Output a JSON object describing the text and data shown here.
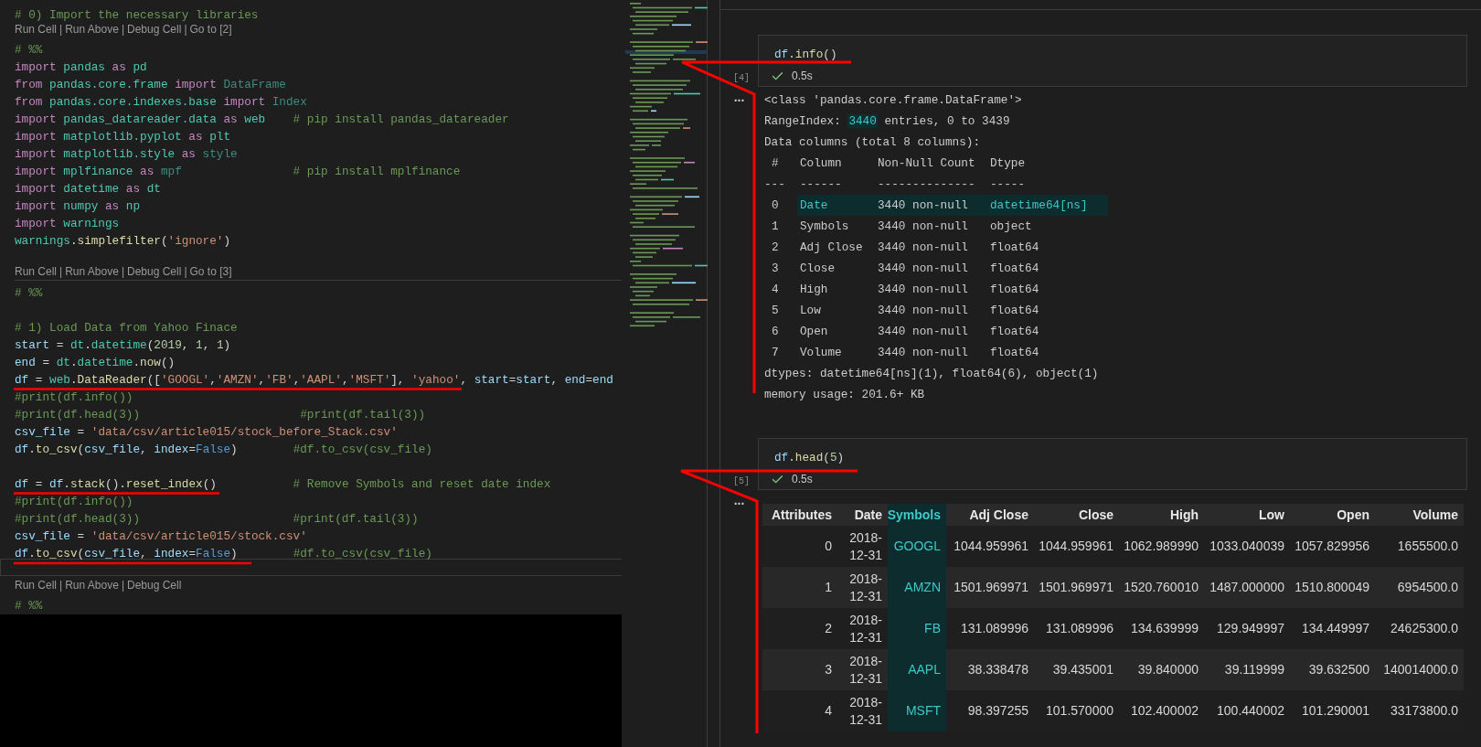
{
  "editor": {
    "lines": [
      {
        "kind": "code",
        "current": false,
        "tokens": [
          {
            "text": "# 0) Import the necessary libraries",
            "kind": "comment"
          }
        ]
      },
      {
        "kind": "codelens",
        "divider_below": false,
        "items": [
          {
            "text": "Run Cell",
            "kind": "link"
          },
          {
            "text": "|",
            "kind": "sep"
          },
          {
            "text": "Run Above",
            "kind": "link"
          },
          {
            "text": "|",
            "kind": "sep"
          },
          {
            "text": "Debug Cell",
            "kind": "link"
          },
          {
            "text": "|",
            "kind": "sep"
          },
          {
            "text": "Go to [2]",
            "kind": "link"
          }
        ]
      },
      {
        "kind": "code",
        "current": false,
        "tokens": [
          {
            "text": "# %%",
            "kind": "comment"
          }
        ]
      },
      {
        "kind": "code",
        "current": false,
        "tokens": [
          {
            "text": "import",
            "kind": "kw"
          },
          {
            "text": " pandas",
            "kind": "mod"
          },
          {
            "text": " as",
            "kind": "kw"
          },
          {
            "text": " pd",
            "kind": "mod"
          }
        ]
      },
      {
        "kind": "code",
        "current": false,
        "tokens": [
          {
            "text": "from",
            "kind": "kw"
          },
          {
            "text": " pandas.core.frame",
            "kind": "mod"
          },
          {
            "text": " import",
            "kind": "kw"
          },
          {
            "text": " DataFrame",
            "kind": "faded"
          }
        ]
      },
      {
        "kind": "code",
        "current": false,
        "tokens": [
          {
            "text": "from",
            "kind": "kw"
          },
          {
            "text": " pandas.core.indexes.base",
            "kind": "mod"
          },
          {
            "text": " import",
            "kind": "kw"
          },
          {
            "text": " Index",
            "kind": "faded"
          }
        ]
      },
      {
        "kind": "code",
        "current": false,
        "tokens": [
          {
            "text": "import",
            "kind": "kw"
          },
          {
            "text": " pandas_datareader.data",
            "kind": "mod"
          },
          {
            "text": " as",
            "kind": "kw"
          },
          {
            "text": " web",
            "kind": "mod"
          },
          {
            "text": "    # pip install pandas_datareader",
            "kind": "comment"
          }
        ]
      },
      {
        "kind": "code",
        "current": false,
        "tokens": [
          {
            "text": "import",
            "kind": "kw"
          },
          {
            "text": " matplotlib.pyplot",
            "kind": "mod"
          },
          {
            "text": " as",
            "kind": "kw"
          },
          {
            "text": " plt",
            "kind": "mod"
          }
        ]
      },
      {
        "kind": "code",
        "current": false,
        "tokens": [
          {
            "text": "import",
            "kind": "kw"
          },
          {
            "text": " matplotlib.style",
            "kind": "mod"
          },
          {
            "text": " as",
            "kind": "kw"
          },
          {
            "text": " style",
            "kind": "faded"
          }
        ]
      },
      {
        "kind": "code",
        "current": false,
        "tokens": [
          {
            "text": "import",
            "kind": "kw"
          },
          {
            "text": " mplfinance",
            "kind": "mod"
          },
          {
            "text": " as",
            "kind": "kw"
          },
          {
            "text": " mpf",
            "kind": "faded"
          },
          {
            "text": "                # pip install mplfinance",
            "kind": "comment"
          }
        ]
      },
      {
        "kind": "code",
        "current": false,
        "tokens": [
          {
            "text": "import",
            "kind": "kw"
          },
          {
            "text": " datetime",
            "kind": "mod"
          },
          {
            "text": " as",
            "kind": "kw"
          },
          {
            "text": " dt",
            "kind": "mod"
          }
        ]
      },
      {
        "kind": "code",
        "current": false,
        "tokens": [
          {
            "text": "import",
            "kind": "kw"
          },
          {
            "text": " numpy",
            "kind": "mod"
          },
          {
            "text": " as",
            "kind": "kw"
          },
          {
            "text": " np",
            "kind": "mod"
          }
        ]
      },
      {
        "kind": "code",
        "current": false,
        "tokens": [
          {
            "text": "import",
            "kind": "kw"
          },
          {
            "text": " warnings",
            "kind": "mod"
          }
        ]
      },
      {
        "kind": "code",
        "current": false,
        "tokens": [
          {
            "text": "warnings",
            "kind": "mod"
          },
          {
            "text": ".",
            "kind": "plain"
          },
          {
            "text": "simplefilter",
            "kind": "fn"
          },
          {
            "text": "(",
            "kind": "plain"
          },
          {
            "text": "'ignore'",
            "kind": "str"
          },
          {
            "text": ")",
            "kind": "plain"
          }
        ]
      },
      {
        "kind": "blank",
        "current": false
      },
      {
        "kind": "codelens",
        "divider_below": true,
        "items": [
          {
            "text": "Run Cell",
            "kind": "link"
          },
          {
            "text": "|",
            "kind": "sep"
          },
          {
            "text": "Run Above",
            "kind": "link"
          },
          {
            "text": "|",
            "kind": "sep"
          },
          {
            "text": "Debug Cell",
            "kind": "link"
          },
          {
            "text": "|",
            "kind": "sep"
          },
          {
            "text": "Go to [3]",
            "kind": "link"
          }
        ]
      },
      {
        "kind": "code",
        "current": false,
        "tokens": [
          {
            "text": "# %%",
            "kind": "comment"
          }
        ]
      },
      {
        "kind": "blank",
        "current": false
      },
      {
        "kind": "code",
        "current": false,
        "tokens": [
          {
            "text": "# 1) Load Data from Yahoo Finace",
            "kind": "comment"
          }
        ]
      },
      {
        "kind": "code",
        "current": false,
        "tokens": [
          {
            "text": "start",
            "kind": "var"
          },
          {
            "text": " = ",
            "kind": "plain"
          },
          {
            "text": "dt",
            "kind": "mod"
          },
          {
            "text": ".",
            "kind": "plain"
          },
          {
            "text": "datetime",
            "kind": "mod"
          },
          {
            "text": "(",
            "kind": "plain"
          },
          {
            "text": "2019",
            "kind": "num"
          },
          {
            "text": ", ",
            "kind": "plain"
          },
          {
            "text": "1",
            "kind": "num"
          },
          {
            "text": ", ",
            "kind": "plain"
          },
          {
            "text": "1",
            "kind": "num"
          },
          {
            "text": ")",
            "kind": "plain"
          }
        ]
      },
      {
        "kind": "code",
        "current": false,
        "tokens": [
          {
            "text": "end",
            "kind": "var"
          },
          {
            "text": " = ",
            "kind": "plain"
          },
          {
            "text": "dt",
            "kind": "mod"
          },
          {
            "text": ".",
            "kind": "plain"
          },
          {
            "text": "datetime",
            "kind": "mod"
          },
          {
            "text": ".",
            "kind": "plain"
          },
          {
            "text": "now",
            "kind": "fn"
          },
          {
            "text": "()",
            "kind": "plain"
          }
        ]
      },
      {
        "kind": "code",
        "current": false,
        "tokens": [
          {
            "text": "df",
            "kind": "var"
          },
          {
            "text": " = ",
            "kind": "plain"
          },
          {
            "text": "web",
            "kind": "mod"
          },
          {
            "text": ".",
            "kind": "plain"
          },
          {
            "text": "DataReader",
            "kind": "fn"
          },
          {
            "text": "([",
            "kind": "plain"
          },
          {
            "text": "'GOOGL'",
            "kind": "str"
          },
          {
            "text": ",",
            "kind": "plain"
          },
          {
            "text": "'AMZN'",
            "kind": "str"
          },
          {
            "text": ",",
            "kind": "plain"
          },
          {
            "text": "'FB'",
            "kind": "str"
          },
          {
            "text": ",",
            "kind": "plain"
          },
          {
            "text": "'AAPL'",
            "kind": "str"
          },
          {
            "text": ",",
            "kind": "plain"
          },
          {
            "text": "'MSFT'",
            "kind": "str"
          },
          {
            "text": "], ",
            "kind": "plain"
          },
          {
            "text": "'yahoo'",
            "kind": "str"
          },
          {
            "text": ", ",
            "kind": "plain"
          },
          {
            "text": "start",
            "kind": "var"
          },
          {
            "text": "=",
            "kind": "plain"
          },
          {
            "text": "start",
            "kind": "var"
          },
          {
            "text": ", ",
            "kind": "plain"
          },
          {
            "text": "end",
            "kind": "var"
          },
          {
            "text": "=",
            "kind": "plain"
          },
          {
            "text": "end",
            "kind": "var"
          }
        ]
      },
      {
        "kind": "code",
        "current": false,
        "tokens": [
          {
            "text": "#print(df.info())",
            "kind": "comment"
          }
        ]
      },
      {
        "kind": "code",
        "current": false,
        "tokens": [
          {
            "text": "#print(df.head(3))                       #print(df.tail(3))",
            "kind": "comment"
          }
        ]
      },
      {
        "kind": "code",
        "current": false,
        "tokens": [
          {
            "text": "csv_file",
            "kind": "var"
          },
          {
            "text": " = ",
            "kind": "plain"
          },
          {
            "text": "'data/csv/article015/stock_before_Stack.csv'",
            "kind": "str"
          }
        ]
      },
      {
        "kind": "code",
        "current": false,
        "tokens": [
          {
            "text": "df",
            "kind": "var"
          },
          {
            "text": ".",
            "kind": "plain"
          },
          {
            "text": "to_csv",
            "kind": "fn"
          },
          {
            "text": "(",
            "kind": "plain"
          },
          {
            "text": "csv_file",
            "kind": "var"
          },
          {
            "text": ", ",
            "kind": "plain"
          },
          {
            "text": "index",
            "kind": "var"
          },
          {
            "text": "=",
            "kind": "plain"
          },
          {
            "text": "False",
            "kind": "const"
          },
          {
            "text": ")",
            "kind": "plain"
          },
          {
            "text": "        #df.to_csv(csv_file)",
            "kind": "comment"
          }
        ]
      },
      {
        "kind": "blank",
        "current": false
      },
      {
        "kind": "code",
        "current": false,
        "tokens": [
          {
            "text": "df",
            "kind": "var"
          },
          {
            "text": " = ",
            "kind": "plain"
          },
          {
            "text": "df",
            "kind": "var"
          },
          {
            "text": ".",
            "kind": "plain"
          },
          {
            "text": "stack",
            "kind": "fn"
          },
          {
            "text": "().",
            "kind": "plain"
          },
          {
            "text": "reset_index",
            "kind": "fn"
          },
          {
            "text": "()",
            "kind": "plain"
          },
          {
            "text": "           # Remove Symbols and reset date index",
            "kind": "comment"
          }
        ]
      },
      {
        "kind": "code",
        "current": false,
        "tokens": [
          {
            "text": "#print(df.info())",
            "kind": "comment"
          }
        ]
      },
      {
        "kind": "code",
        "current": false,
        "tokens": [
          {
            "text": "#print(df.head(3))                      #print(df.tail(3))",
            "kind": "comment"
          }
        ]
      },
      {
        "kind": "code",
        "current": false,
        "tokens": [
          {
            "text": "csv_file",
            "kind": "var"
          },
          {
            "text": " = ",
            "kind": "plain"
          },
          {
            "text": "'data/csv/article015/stock.csv'",
            "kind": "str"
          }
        ]
      },
      {
        "kind": "code",
        "current": false,
        "tokens": [
          {
            "text": "df",
            "kind": "var"
          },
          {
            "text": ".",
            "kind": "plain"
          },
          {
            "text": "to_csv",
            "kind": "fn"
          },
          {
            "text": "(",
            "kind": "plain"
          },
          {
            "text": "csv_file",
            "kind": "var"
          },
          {
            "text": ", ",
            "kind": "plain"
          },
          {
            "text": "index",
            "kind": "var"
          },
          {
            "text": "=",
            "kind": "plain"
          },
          {
            "text": "False",
            "kind": "const"
          },
          {
            "text": ")",
            "kind": "plain"
          },
          {
            "text": "        #df.to_csv(csv_file)",
            "kind": "comment"
          }
        ]
      },
      {
        "kind": "blank",
        "current": true
      },
      {
        "kind": "codelens",
        "divider_below": false,
        "items": [
          {
            "text": "Run Cell",
            "kind": "link"
          },
          {
            "text": "|",
            "kind": "sep"
          },
          {
            "text": "Run Above",
            "kind": "link"
          },
          {
            "text": "|",
            "kind": "sep"
          },
          {
            "text": "Debug Cell",
            "kind": "link"
          }
        ]
      },
      {
        "kind": "code",
        "current": false,
        "tokens": [
          {
            "text": "# %%",
            "kind": "comment"
          }
        ]
      }
    ]
  },
  "notebook": {
    "cells": [
      {
        "kind": "info",
        "execution_count": "[4]",
        "code": [
          {
            "text": "df",
            "kind": "var"
          },
          {
            "text": ".",
            "kind": "plain"
          },
          {
            "text": "info",
            "kind": "fn"
          },
          {
            "text": "()",
            "kind": "plain"
          }
        ],
        "duration": "0.5s",
        "output_marker": "...",
        "output": {
          "lines": [
            {
              "segments": [
                {
                  "text": "<class 'pandas.core.frame.DataFrame'>",
                  "highlighted": false
                }
              ]
            },
            {
              "segments": [
                {
                  "text": "RangeIndex: ",
                  "highlighted": false
                },
                {
                  "text": "3440",
                  "highlighted": true
                },
                {
                  "text": " entries, 0 to 3439",
                  "highlighted": false
                }
              ]
            },
            {
              "segments": [
                {
                  "text": "Data columns (total 8 columns):",
                  "highlighted": false
                }
              ]
            }
          ],
          "columns": [
            "#",
            "Column",
            "Non-Null Count",
            "Dtype"
          ],
          "rule": [
            "---",
            "------",
            "--------------",
            "-----"
          ],
          "rows": [
            {
              "index": "0",
              "column": "Date",
              "count": "3440 non-null",
              "dtype": "datetime64[ns]",
              "selected": true
            },
            {
              "index": "1",
              "column": "Symbols",
              "count": "3440 non-null",
              "dtype": "object",
              "selected": false
            },
            {
              "index": "2",
              "column": "Adj Close",
              "count": "3440 non-null",
              "dtype": "float64",
              "selected": false
            },
            {
              "index": "3",
              "column": "Close",
              "count": "3440 non-null",
              "dtype": "float64",
              "selected": false
            },
            {
              "index": "4",
              "column": "High",
              "count": "3440 non-null",
              "dtype": "float64",
              "selected": false
            },
            {
              "index": "5",
              "column": "Low",
              "count": "3440 non-null",
              "dtype": "float64",
              "selected": false
            },
            {
              "index": "6",
              "column": "Open",
              "count": "3440 non-null",
              "dtype": "float64",
              "selected": false
            },
            {
              "index": "7",
              "column": "Volume",
              "count": "3440 non-null",
              "dtype": "float64",
              "selected": false
            }
          ],
          "footer": [
            "dtypes: datetime64[ns](1), float64(6), object(1)",
            "memory usage: 201.6+ KB"
          ]
        }
      },
      {
        "kind": "table",
        "execution_count": "[5]",
        "code": [
          {
            "text": "df",
            "kind": "var"
          },
          {
            "text": ".",
            "kind": "plain"
          },
          {
            "text": "head",
            "kind": "fn"
          },
          {
            "text": "(",
            "kind": "plain"
          },
          {
            "text": "5",
            "kind": "num"
          },
          {
            "text": ")",
            "kind": "plain"
          }
        ],
        "duration": "0.5s",
        "output_marker": "...",
        "output": {
          "columns": [
            {
              "label": "Attributes",
              "selected": false
            },
            {
              "label": "Date",
              "selected": false
            },
            {
              "label": "Symbols",
              "selected": true
            },
            {
              "label": "Adj Close",
              "selected": false
            },
            {
              "label": "Close",
              "selected": false
            },
            {
              "label": "High",
              "selected": false
            },
            {
              "label": "Low",
              "selected": false
            },
            {
              "label": "Open",
              "selected": false
            },
            {
              "label": "Volume",
              "selected": false
            }
          ],
          "rows": [
            [
              "0",
              "2018-12-31",
              "GOOGL",
              "1044.959961",
              "1044.959961",
              "1062.989990",
              "1033.040039",
              "1057.829956",
              "1655500.0"
            ],
            [
              "1",
              "2018-12-31",
              "AMZN",
              "1501.969971",
              "1501.969971",
              "1520.760010",
              "1487.000000",
              "1510.800049",
              "6954500.0"
            ],
            [
              "2",
              "2018-12-31",
              "FB",
              "131.089996",
              "131.089996",
              "134.639999",
              "129.949997",
              "134.449997",
              "24625300.0"
            ],
            [
              "3",
              "2018-12-31",
              "AAPL",
              "38.338478",
              "39.435001",
              "39.840000",
              "39.119999",
              "39.632500",
              "140014000.0"
            ],
            [
              "4",
              "2018-12-31",
              "MSFT",
              "98.397255",
              "101.570000",
              "102.400002",
              "100.440002",
              "101.290001",
              "33173800.0"
            ]
          ]
        }
      }
    ]
  }
}
